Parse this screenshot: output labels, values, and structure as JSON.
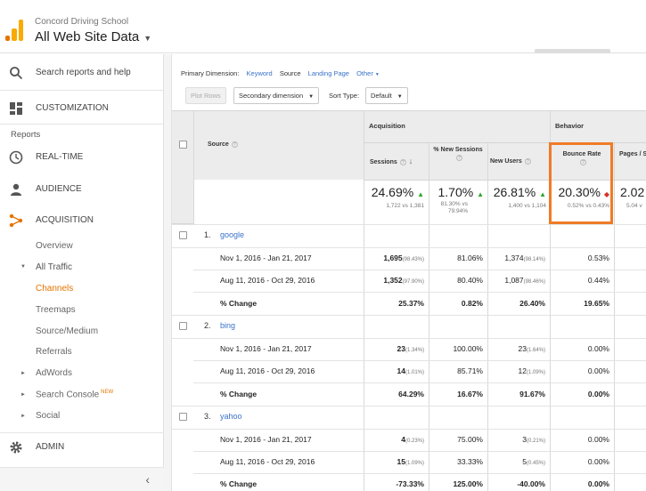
{
  "header": {
    "account": "Concord Driving School",
    "property": "All Web Site Data",
    "brand_color": "#f9ab00"
  },
  "sidebar": {
    "search": "Search reports and help",
    "customization": "CUSTOMIZATION",
    "reports": "Reports",
    "realtime": "REAL-TIME",
    "audience": "AUDIENCE",
    "acquisition": "ACQUISITION",
    "overview": "Overview",
    "all_traffic": "All Traffic",
    "channels": "Channels",
    "treemaps": "Treemaps",
    "source_medium": "Source/Medium",
    "referrals": "Referrals",
    "adwords": "AdWords",
    "search_console": "Search Console",
    "new_badge": "NEW",
    "social": "Social",
    "admin": "ADMIN",
    "active_color": "#e37400"
  },
  "toolbar": {
    "primary_dimension": "Primary Dimension:",
    "keyword": "Keyword",
    "source": "Source",
    "landing_page": "Landing Page",
    "other": "Other",
    "plot_rows": "Plot Rows",
    "secondary_dimension": "Secondary dimension",
    "sort_type": "Sort Type:",
    "default": "Default"
  },
  "table": {
    "group_acquisition": "Acquisition",
    "group_behavior": "Behavior",
    "col_source": "Source",
    "col_sessions": "Sessions",
    "col_new_sessions": "% New Sessions",
    "col_new_users": "New Users",
    "col_bounce": "Bounce Rate",
    "col_pages": "Pages / Session",
    "summary": {
      "sessions": "24.69%",
      "sessions_sub": "1,722 vs 1,381",
      "new_sessions": "1.70%",
      "new_sessions_sub": "81.30% vs 79.94%",
      "new_users": "26.81%",
      "new_users_sub": "1,400 vs 1,104",
      "bounce": "20.30%",
      "bounce_sub": "0.52% vs 0.43%",
      "pages": "2.02",
      "pages_sub": "5.04 v"
    },
    "groups": [
      {
        "index": "1.",
        "source": "google",
        "rows": [
          {
            "label": "Nov 1, 2016 - Jan 21, 2017",
            "sessions": "1,695",
            "sessions_pct": "(98.43%)",
            "new_sessions": "81.06%",
            "new_users": "1,374",
            "new_users_pct": "(98.14%)",
            "bounce": "0.53%"
          },
          {
            "label": "Aug 11, 2016 - Oct 29, 2016",
            "sessions": "1,352",
            "sessions_pct": "(97.90%)",
            "new_sessions": "80.40%",
            "new_users": "1,087",
            "new_users_pct": "(98.46%)",
            "bounce": "0.44%"
          },
          {
            "label": "% Change",
            "sessions": "25.37%",
            "new_sessions": "0.82%",
            "new_users": "26.40%",
            "bounce": "19.65%"
          }
        ]
      },
      {
        "index": "2.",
        "source": "bing",
        "rows": [
          {
            "label": "Nov 1, 2016 - Jan 21, 2017",
            "sessions": "23",
            "sessions_pct": "(1.34%)",
            "new_sessions": "100.00%",
            "new_users": "23",
            "new_users_pct": "(1.64%)",
            "bounce": "0.00%"
          },
          {
            "label": "Aug 11, 2016 - Oct 29, 2016",
            "sessions": "14",
            "sessions_pct": "(1.01%)",
            "new_sessions": "85.71%",
            "new_users": "12",
            "new_users_pct": "(1.09%)",
            "bounce": "0.00%"
          },
          {
            "label": "% Change",
            "sessions": "64.29%",
            "new_sessions": "16.67%",
            "new_users": "91.67%",
            "bounce": "0.00%"
          }
        ]
      },
      {
        "index": "3.",
        "source": "yahoo",
        "rows": [
          {
            "label": "Nov 1, 2016 - Jan 21, 2017",
            "sessions": "4",
            "sessions_pct": "(0.23%)",
            "new_sessions": "75.00%",
            "new_users": "3",
            "new_users_pct": "(0.21%)",
            "bounce": "0.00%"
          },
          {
            "label": "Aug 11, 2016 - Oct 29, 2016",
            "sessions": "15",
            "sessions_pct": "(1.09%)",
            "new_sessions": "33.33%",
            "new_users": "5",
            "new_users_pct": "(0.45%)",
            "bounce": "0.00%"
          },
          {
            "label": "% Change",
            "sessions": "-73.33%",
            "new_sessions": "125.00%",
            "new_users": "-40.00%",
            "bounce": "0.00%"
          }
        ]
      }
    ],
    "highlight_color": "#f07b27",
    "link_color": "#3a73c9",
    "up_color": "#2ba52b",
    "down_color": "#d93025"
  }
}
